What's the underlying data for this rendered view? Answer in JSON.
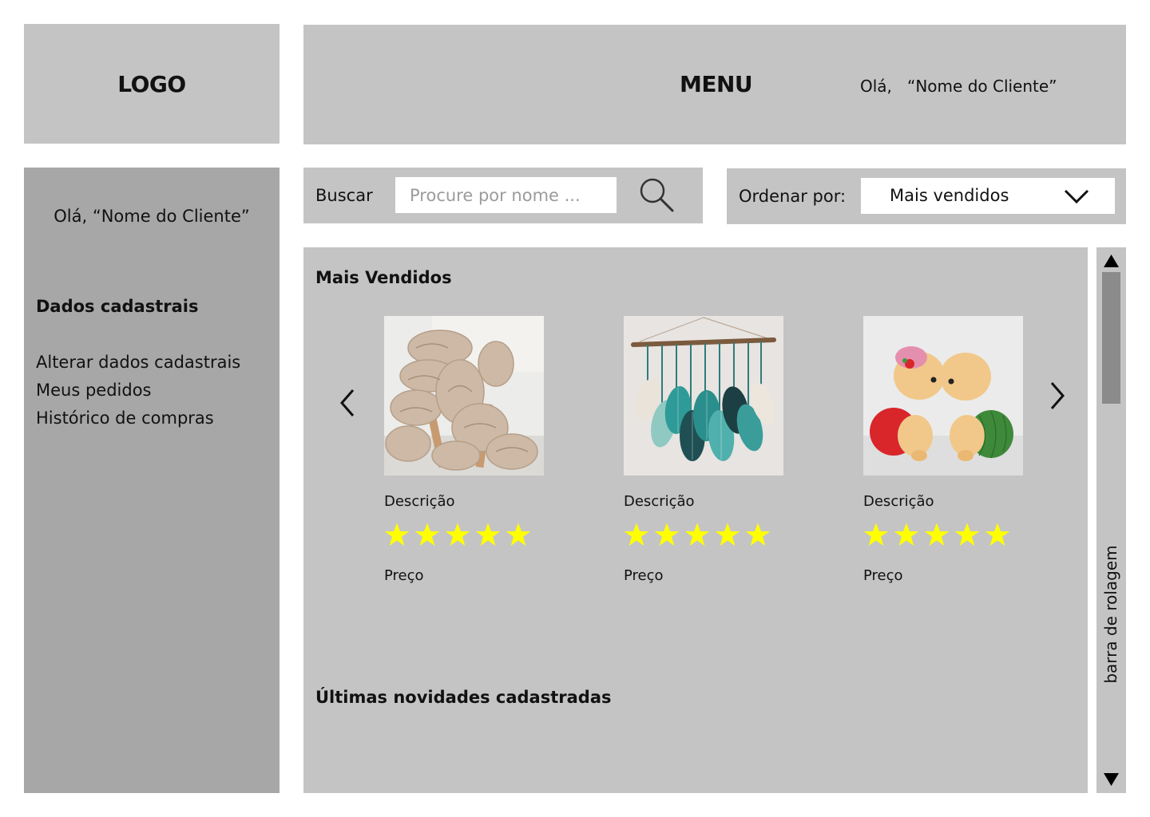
{
  "header": {
    "logo_text": "LOGO",
    "menu_text": "MENU",
    "greeting": "Olá,   “Nome do Cliente”"
  },
  "sidebar": {
    "greeting": "Olá, “Nome do Cliente”",
    "section_title": "Dados cadastrais",
    "links": [
      "Alterar dados cadastrais",
      "Meus pedidos",
      "Histórico de compras"
    ]
  },
  "search": {
    "label": "Buscar",
    "placeholder": "Procure por nome ...",
    "icon": "magnifier-icon"
  },
  "sort": {
    "label": "Ordenar por:",
    "selected": "Mais vendidos",
    "icon": "chevron-down-icon"
  },
  "best_sellers": {
    "title": "Mais Vendidos",
    "products": [
      {
        "image": "knit-blanket-photo",
        "description": "Descrição",
        "rating": 5,
        "price": "Preço"
      },
      {
        "image": "macrame-leaves-photo",
        "description": "Descrição",
        "rating": 5,
        "price": "Preço"
      },
      {
        "image": "amigurumi-turtles-photo",
        "description": "Descrição",
        "rating": 5,
        "price": "Preço"
      }
    ],
    "star_color": "#ffff00"
  },
  "new_arrivals": {
    "title": "Últimas novidades cadastradas"
  },
  "scrollbar": {
    "label": "barra de rolagem"
  }
}
